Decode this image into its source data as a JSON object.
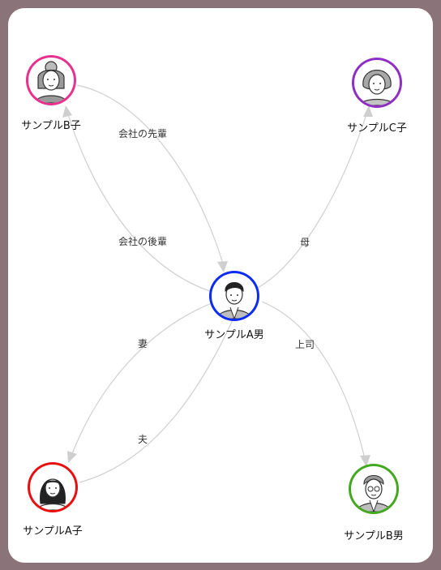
{
  "nodes": {
    "a_otoko": {
      "label": "サンプルA男",
      "color": "#0b2cf2",
      "avatar": "man-young-icon"
    },
    "b_ko": {
      "label": "サンプルB子",
      "color": "#e8318e",
      "avatar": "woman-bun-icon"
    },
    "c_ko": {
      "label": "サンプルC子",
      "color": "#8e2fc4",
      "avatar": "woman-elder-icon"
    },
    "a_ko": {
      "label": "サンプルA子",
      "color": "#e80f0f",
      "avatar": "woman-longhair-icon"
    },
    "b_otoko": {
      "label": "サンプルB男",
      "color": "#43a81f",
      "avatar": "man-elder-glasses-icon"
    }
  },
  "edges": {
    "b_ko_to_a_otoko": "会社の先輩",
    "a_otoko_to_b_ko": "会社の後輩",
    "a_otoko_to_c_ko": "母",
    "a_otoko_to_a_ko": "妻",
    "a_ko_to_a_otoko": "夫",
    "a_otoko_to_b_otoko": "上司"
  },
  "colors": {
    "frame": "#8a7379",
    "edge": "#cfcfcf"
  }
}
